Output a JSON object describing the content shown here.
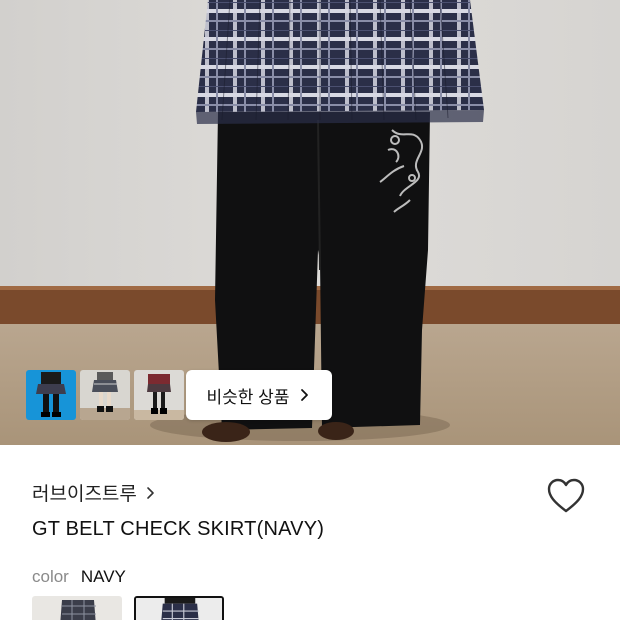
{
  "hero": {
    "similar_products_label": "비슷한 상품",
    "thumbnails": [
      {
        "name": "similar-thumb-1"
      },
      {
        "name": "similar-thumb-2"
      },
      {
        "name": "similar-thumb-3"
      }
    ]
  },
  "product": {
    "brand": "러브이즈트루",
    "title": "GT BELT CHECK SKIRT(NAVY)",
    "color_key": "color",
    "color_value": "NAVY"
  },
  "icons": {
    "brand_chevron": "chevron-right-icon",
    "similar_chevron": "chevron-right-icon",
    "wishlist": "heart-outline-icon"
  },
  "colors": {
    "skirt_navy": "#2a2e45",
    "wall": "#d9d7d4",
    "floor": "#b8a58d",
    "baseboard": "#7a4a2c"
  }
}
